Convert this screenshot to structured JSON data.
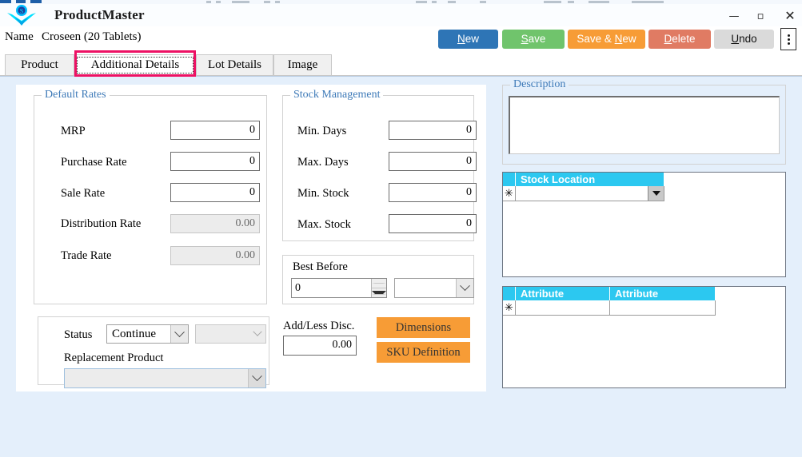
{
  "window": {
    "title": "ProductMaster",
    "minimize_label": "—",
    "maximize_label": "▫",
    "close_label": "✕"
  },
  "header": {
    "name_label": "Name",
    "name_value": "Croseen (20 Tablets)"
  },
  "toolbar": {
    "new_label": "New",
    "save_label": "Save",
    "save_new_label": "Save & New",
    "delete_label": "Delete",
    "undo_label": "Undo"
  },
  "tabs": [
    {
      "label": "Product",
      "active": false
    },
    {
      "label": "Additional Details",
      "active": true
    },
    {
      "label": "Lot Details",
      "active": false
    },
    {
      "label": "Image",
      "active": false
    }
  ],
  "default_rates": {
    "title": "Default Rates",
    "fields": [
      {
        "label": "MRP",
        "value": "0",
        "disabled": false
      },
      {
        "label": "Purchase Rate",
        "value": "0",
        "disabled": false
      },
      {
        "label": "Sale Rate",
        "value": "0",
        "disabled": false
      },
      {
        "label": "Distribution Rate",
        "value": "0.00",
        "disabled": true
      },
      {
        "label": "Trade Rate",
        "value": "0.00",
        "disabled": true
      }
    ]
  },
  "status_panel": {
    "status_label": "Status",
    "status_value": "Continue",
    "secondary_value": "",
    "replacement_label": "Replacement Product",
    "replacement_value": ""
  },
  "stock_management": {
    "title": "Stock Management",
    "fields": [
      {
        "label": "Min. Days",
        "value": "0"
      },
      {
        "label": "Max. Days",
        "value": "0"
      },
      {
        "label": "Min. Stock",
        "value": "0"
      },
      {
        "label": "Max. Stock",
        "value": "0"
      }
    ]
  },
  "best_before": {
    "title": "Best Before",
    "value": "0",
    "unit_value": ""
  },
  "discount": {
    "label": "Add/Less Disc.",
    "value": "0.00"
  },
  "action_buttons": {
    "dimensions_label": "Dimensions",
    "sku_definition_label": "SKU Definition"
  },
  "description": {
    "title": "Description",
    "value": ""
  },
  "stock_location_grid": {
    "columns": [
      "Stock Location"
    ],
    "new_row_marker": "✳",
    "rows": []
  },
  "attribute_grid": {
    "columns": [
      "Attribute",
      "Attribute"
    ],
    "new_row_marker": "✳",
    "rows": []
  },
  "colors": {
    "accent_blue": "#2E75B6",
    "accent_green": "#70C46C",
    "accent_orange": "#F79C36",
    "accent_red": "#E07B63",
    "accent_gray": "#DADADA",
    "grid_header_cyan": "#2CC8F0",
    "page_background": "#E4EFFB",
    "highlight_pink": "#ED1164",
    "groupbox_title": "#3E7AB8"
  }
}
